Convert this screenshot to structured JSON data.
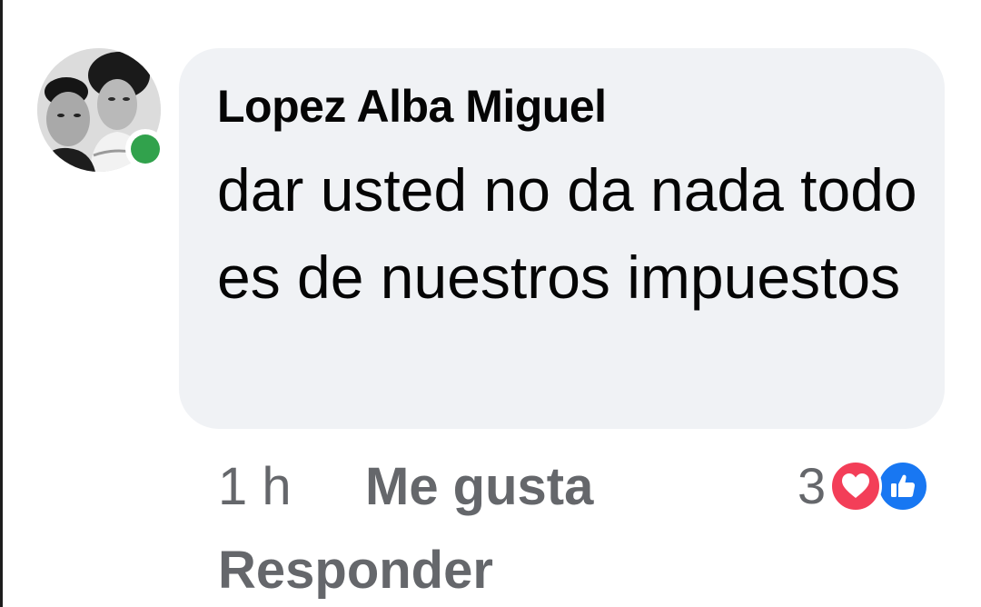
{
  "comment": {
    "author": "Lopez Alba Miguel",
    "text": "dar usted no da nada todo es de nuestros impuestos",
    "avatar_icon": "profile-photo-icon",
    "online": true,
    "online_color": "#31a24c"
  },
  "actions": {
    "time": "1 h",
    "like_label": "Me gusta",
    "reply_label": "Responder"
  },
  "reactions": {
    "count": "3",
    "types": [
      "love-reaction-icon",
      "like-reaction-icon"
    ],
    "love_color": "#f33e58",
    "like_color": "#1877f2"
  },
  "colors": {
    "bubble": "#f0f2f5",
    "text": "#050505",
    "secondary_text": "#65676b"
  }
}
